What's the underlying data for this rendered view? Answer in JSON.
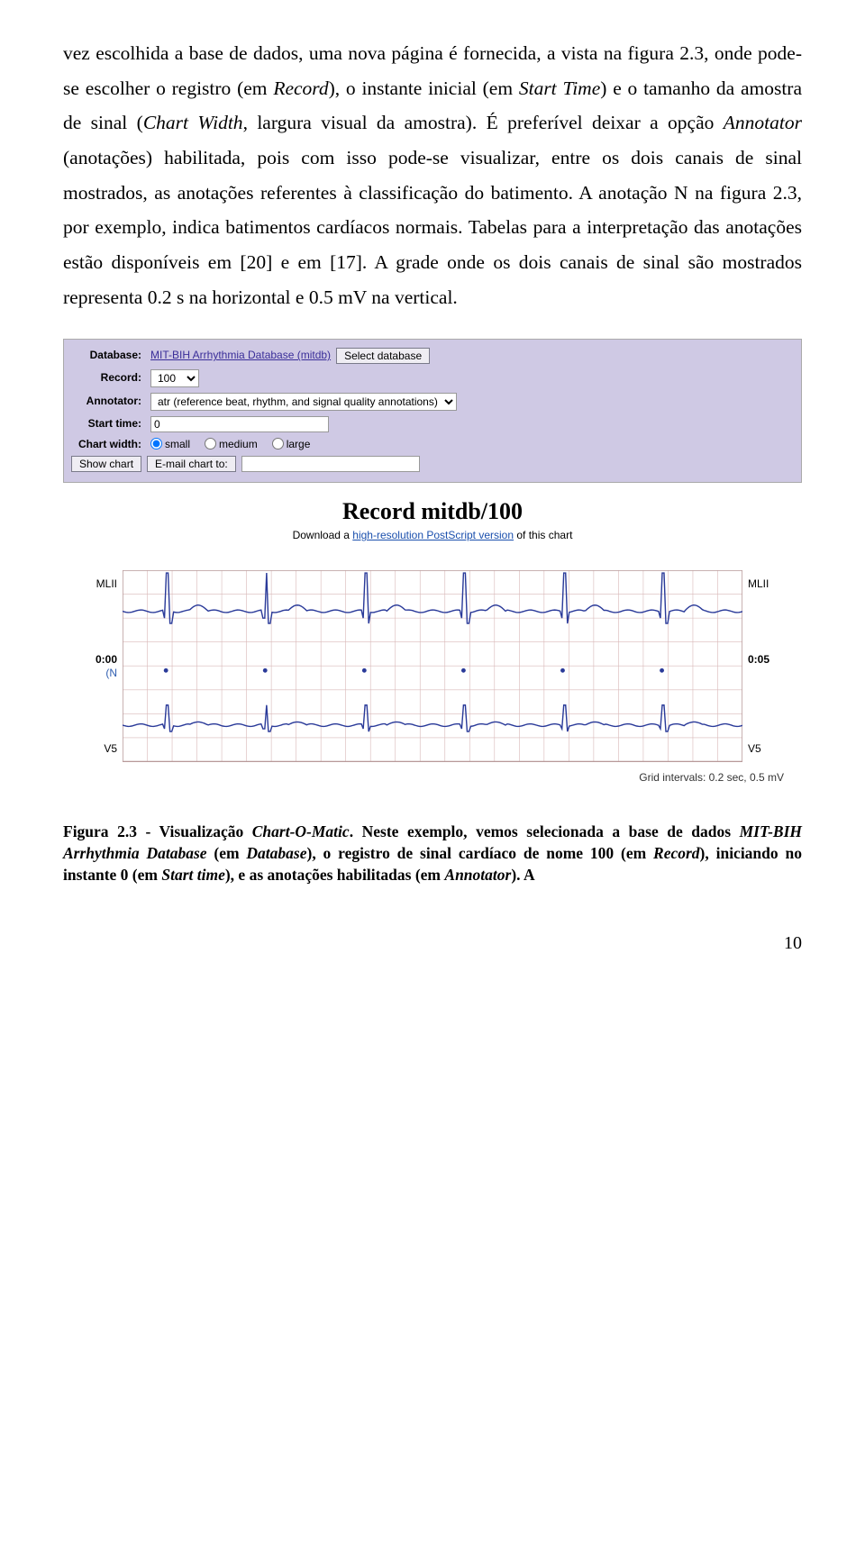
{
  "para": {
    "t1": "vez escolhida a base de dados, uma nova página é fornecida, a vista na figura 2.3, onde pode-se escolher o registro (em ",
    "i1": "Record",
    "t2": "), o instante inicial (em ",
    "i2": "Start Time",
    "t3": ") e o tamanho da amostra de sinal (",
    "i3": "Chart Width",
    "t4": ", largura visual da amostra). É preferível deixar a opção ",
    "i4": "Annotator",
    "t5": " (anotações) habilitada, pois com isso pode-se visualizar, entre os dois canais de sinal mostrados, as anotações referentes à classificação do batimento. A anotação N na figura 2.3, por exemplo, indica batimentos cardíacos normais. Tabelas para a interpretação das anotações estão disponíveis em [20] e em [17]. A grade onde os dois canais de sinal são mostrados representa 0.2 s na horizontal e 0.5 mV na vertical."
  },
  "panel": {
    "databaseLabel": "Database:",
    "databaseValue": "MIT-BIH Arrhythmia Database (mitdb)",
    "selectDbBtn": "Select database",
    "recordLabel": "Record:",
    "recordValue": "100",
    "annotatorLabel": "Annotator:",
    "annotatorValue": "atr (reference beat, rhythm, and signal quality annotations)",
    "startLabel": "Start time:",
    "startValue": "0",
    "chartWidthLabel": "Chart width:",
    "rSmall": "small",
    "rMedium": "medium",
    "rLarge": "large",
    "showChartBtn": "Show chart",
    "emailBtn": "E-mail chart to:"
  },
  "record": {
    "title": "Record mitdb/100",
    "subPre": "Download a ",
    "subLink": "high-resolution PostScript version",
    "subPost": " of this chart"
  },
  "chart_data": {
    "type": "line",
    "xlabel_left": "0:00",
    "xlabel_right": "0:05",
    "grid_note": "Grid intervals: 0.2 sec, 0.5 mV",
    "grid_x_sec": 0.2,
    "grid_y_mV": 0.5,
    "time_range_sec": [
      0,
      5
    ],
    "annotation_row": "(N",
    "beat_marks_sec": [
      0.35,
      1.15,
      1.95,
      2.75,
      3.55,
      4.35
    ],
    "series": [
      {
        "name": "MLII",
        "label_left": "MLII",
        "label_right": "MLII"
      },
      {
        "name": "V5",
        "label_left": "V5",
        "label_right": "V5"
      }
    ]
  },
  "caption": {
    "c1": "Figura 2.3 - Visualização ",
    "i1": "Chart-O-Matic",
    "c2": ". Neste exemplo, vemos selecionada a base de dados ",
    "i2": "MIT-BIH Arrhythmia Database",
    "c3": " (em ",
    "i3": "Database",
    "c4": "), o registro de sinal cardíaco de nome 100 (em ",
    "i4": "Record",
    "c5": "), iniciando no instante 0 (em ",
    "i5": "Start time",
    "c6": "), e as anotações habilitadas (em ",
    "i6": "Annotator",
    "c7": "). A"
  },
  "pagenum": "10"
}
